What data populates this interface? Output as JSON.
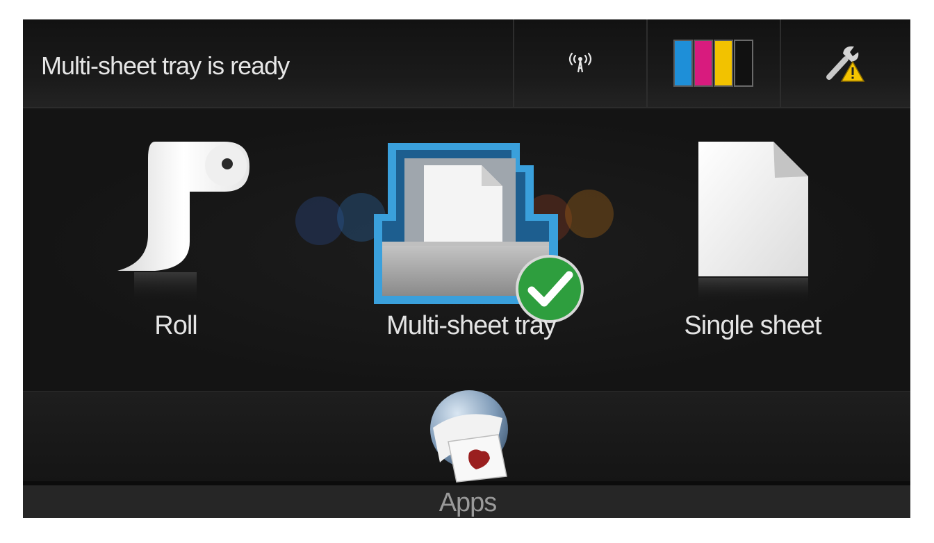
{
  "status_bar": {
    "message": "Multi-sheet tray is ready",
    "icons": [
      "wireless-icon",
      "ink-cartridges-icon",
      "tools-warning-icon"
    ]
  },
  "colors": {
    "background": "#151515",
    "ink_cyan": "#1e8fd8",
    "ink_magenta": "#d81b7e",
    "ink_yellow": "#f2c200",
    "ink_black": "#111111",
    "tray_blue": "#3aa0dc",
    "check_green": "#2e9e3e",
    "warning_yellow": "#f5c400"
  },
  "tiles": [
    {
      "label": "Roll",
      "icon": "paper-roll-icon",
      "selected": false
    },
    {
      "label": "Multi-sheet tray",
      "icon": "multi-sheet-tray-icon",
      "selected": true
    },
    {
      "label": "Single sheet",
      "icon": "single-sheet-icon",
      "selected": false
    }
  ],
  "apps": {
    "label": "Apps",
    "icon": "apps-globe-icon"
  }
}
